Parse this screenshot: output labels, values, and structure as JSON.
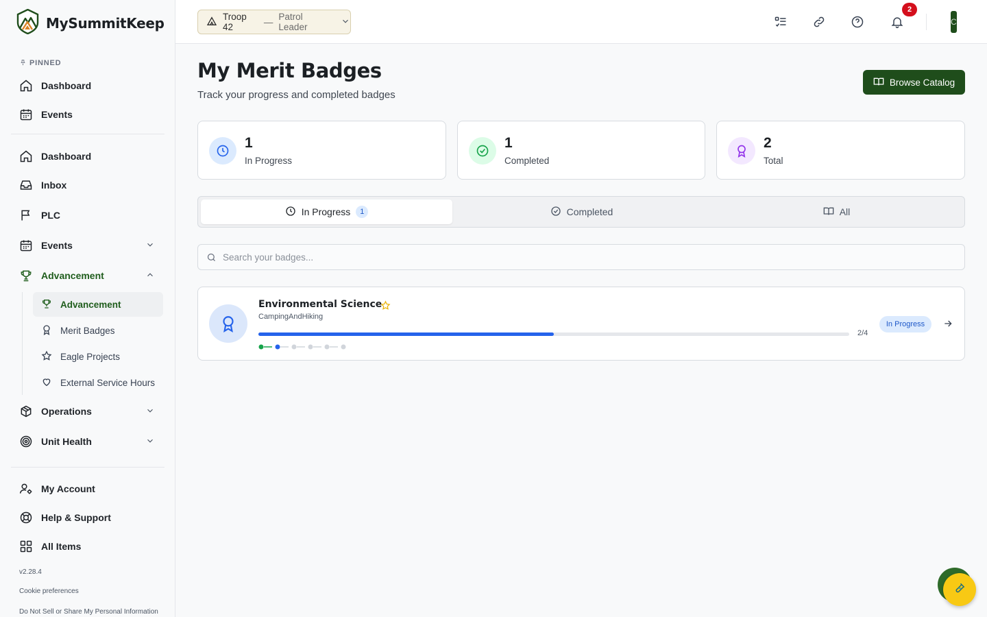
{
  "app": {
    "name": "MySummitKeep",
    "version": "v2.28.4"
  },
  "sidebar": {
    "pinned_label": "PINNED",
    "pinned": [
      {
        "label": "Dashboard",
        "icon": "home-icon"
      },
      {
        "label": "Events",
        "icon": "calendar-icon"
      }
    ],
    "items": [
      {
        "label": "Dashboard",
        "icon": "home-icon"
      },
      {
        "label": "Inbox",
        "icon": "inbox-icon"
      },
      {
        "label": "PLC",
        "icon": "flag-icon"
      },
      {
        "label": "Events",
        "icon": "calendar-icon",
        "expandable": true
      },
      {
        "label": "Advancement",
        "icon": "trophy-icon",
        "expanded": true,
        "active": true
      },
      {
        "label": "Operations",
        "icon": "box-icon",
        "expandable": true
      },
      {
        "label": "Unit Health",
        "icon": "target-icon",
        "expandable": true
      }
    ],
    "advancement_sub": [
      {
        "label": "Advancement",
        "icon": "trophy-icon",
        "active": true
      },
      {
        "label": "Merit Badges",
        "icon": "award-icon"
      },
      {
        "label": "Eagle Projects",
        "icon": "star-icon"
      },
      {
        "label": "External Service Hours",
        "icon": "heart-icon"
      }
    ],
    "bottom": [
      {
        "label": "My Account",
        "icon": "user-settings-icon"
      },
      {
        "label": "Help & Support",
        "icon": "lifebuoy-icon"
      },
      {
        "label": "All Items",
        "icon": "grid-icon"
      }
    ],
    "cookie_link": "Cookie preferences",
    "privacy_link": "Do Not Sell or Share My Personal Information"
  },
  "header": {
    "troop": "Troop 42",
    "role": "Patrol Leader",
    "separator": "—",
    "notification_count": "2",
    "avatar_initial": "C"
  },
  "main": {
    "title": "My Merit Badges",
    "subtitle": "Track your progress and completed badges",
    "browse_button": "Browse Catalog",
    "stats": [
      {
        "value": "1",
        "label": "In Progress",
        "color": "#2563eb",
        "bg": "#dbeafe",
        "icon": "clock-icon"
      },
      {
        "value": "1",
        "label": "Completed",
        "color": "#16a34a",
        "bg": "#dcfce7",
        "icon": "check-circle-icon"
      },
      {
        "value": "2",
        "label": "Total",
        "color": "#9333ea",
        "bg": "#f3e8ff",
        "icon": "award-icon"
      }
    ],
    "tabs": [
      {
        "label": "In Progress",
        "count": "1",
        "active": true
      },
      {
        "label": "Completed"
      },
      {
        "label": "All"
      }
    ],
    "search_placeholder": "Search your badges...",
    "badges": [
      {
        "name": "Environmental Science",
        "category": "CampingAndHiking",
        "progress_fraction": 0.5,
        "progress_text": "2/4",
        "status": "In Progress",
        "eagle_required": true
      }
    ]
  },
  "colors": {
    "brand_green": "#1f4d1b",
    "accent_blue": "#2563eb",
    "notification_red": "#d40f1c"
  }
}
